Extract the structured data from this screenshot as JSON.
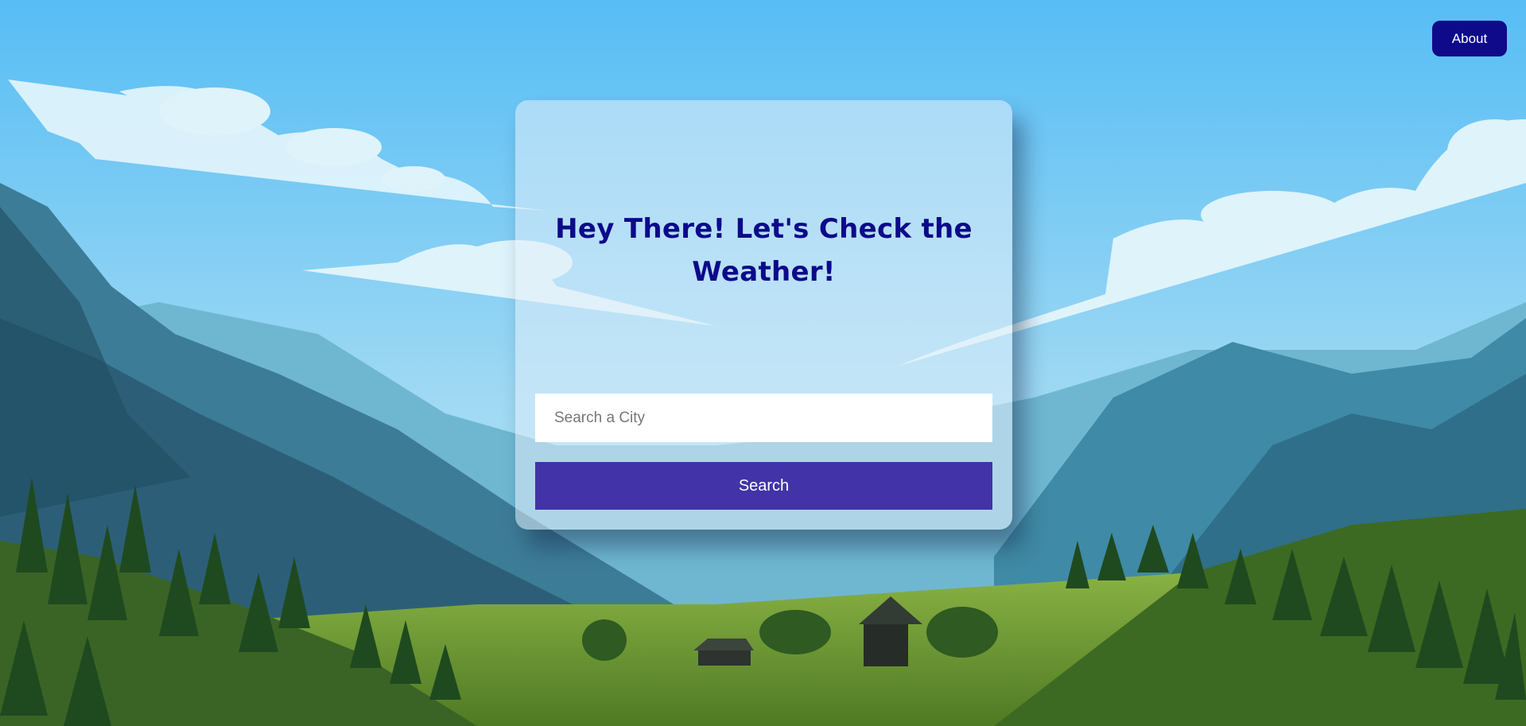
{
  "header": {
    "about_label": "About"
  },
  "card": {
    "title": "Hey There! Let's Check the Weather!",
    "search_placeholder": "Search a City",
    "search_value": "",
    "search_button_label": "Search"
  },
  "colors": {
    "sky": "#5bbdf3",
    "accent_dark": "#0f0a8a",
    "button": "#4233a8",
    "title": "#0d0a8a"
  }
}
